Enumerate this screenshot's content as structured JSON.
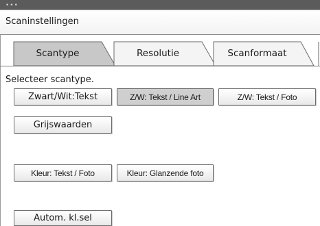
{
  "window": {
    "title": "Scaninstellingen"
  },
  "tabs": [
    {
      "label": "Scantype",
      "active": true
    },
    {
      "label": "Resolutie",
      "active": false
    },
    {
      "label": "Scanformaat",
      "active": false
    }
  ],
  "instruction": "Selecteer scantype.",
  "scan_types": [
    {
      "label": "Zwart/Wit:Tekst",
      "selected": false
    },
    {
      "label": "Z/W: Tekst / Line Art",
      "selected": true
    },
    {
      "label": "Z/W: Tekst / Foto",
      "selected": false
    },
    {
      "label": "Grijswaarden",
      "selected": false
    },
    {
      "label": "Kleur: Tekst / Foto",
      "selected": false
    },
    {
      "label": "Kleur: Glanzende foto",
      "selected": false
    },
    {
      "label": "Autom. kl.sel",
      "selected": false
    }
  ],
  "colors": {
    "active_tab": "#c8c8c8",
    "selected_button": "#cfcfcf",
    "title_bar": "#5b5b5b"
  }
}
